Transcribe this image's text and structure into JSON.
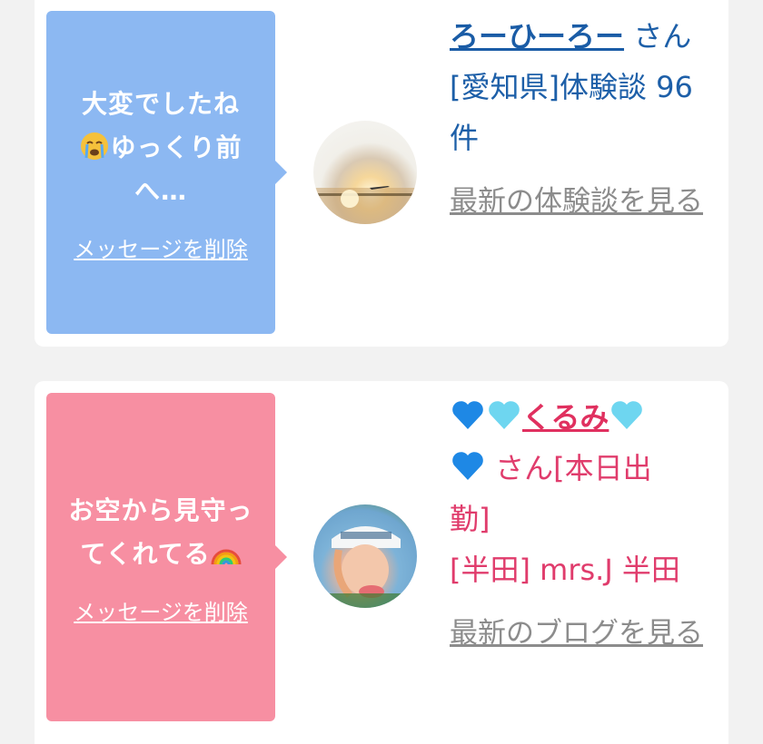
{
  "cards": [
    {
      "message": {
        "text_line1": "大変でしたね",
        "text_line2": "ゆっくり前",
        "text_line3": "へ…",
        "emoji": "crying-face",
        "delete_label": "メッセージを削除",
        "color": "#8cb8f2"
      },
      "avatar": "sunset-plane-photo",
      "name": "ろーひーろー",
      "suffix": "さん",
      "area_line1": "[愛知県]体験談 96",
      "area_line2": "件",
      "latest_label": "最新の体験談を見る"
    },
    {
      "message": {
        "text_line1": "お空から見守っ",
        "text_line2": "てくれてる",
        "emoji": "rainbow",
        "delete_label": "メッセージを削除",
        "color": "#f78fa2"
      },
      "avatar": "woman-cap-photo",
      "name": "くるみ",
      "suffix": "さん[本日出",
      "suffix2": "勤]",
      "area_line1": "[半田] mrs.J 半田",
      "latest_label": "最新のブログを見る"
    }
  ],
  "colors": {
    "background": "#f2f2f2",
    "blue_text": "#1d5fa8",
    "pink_text": "#e03c6c",
    "link_gray": "#8c8c8c"
  }
}
